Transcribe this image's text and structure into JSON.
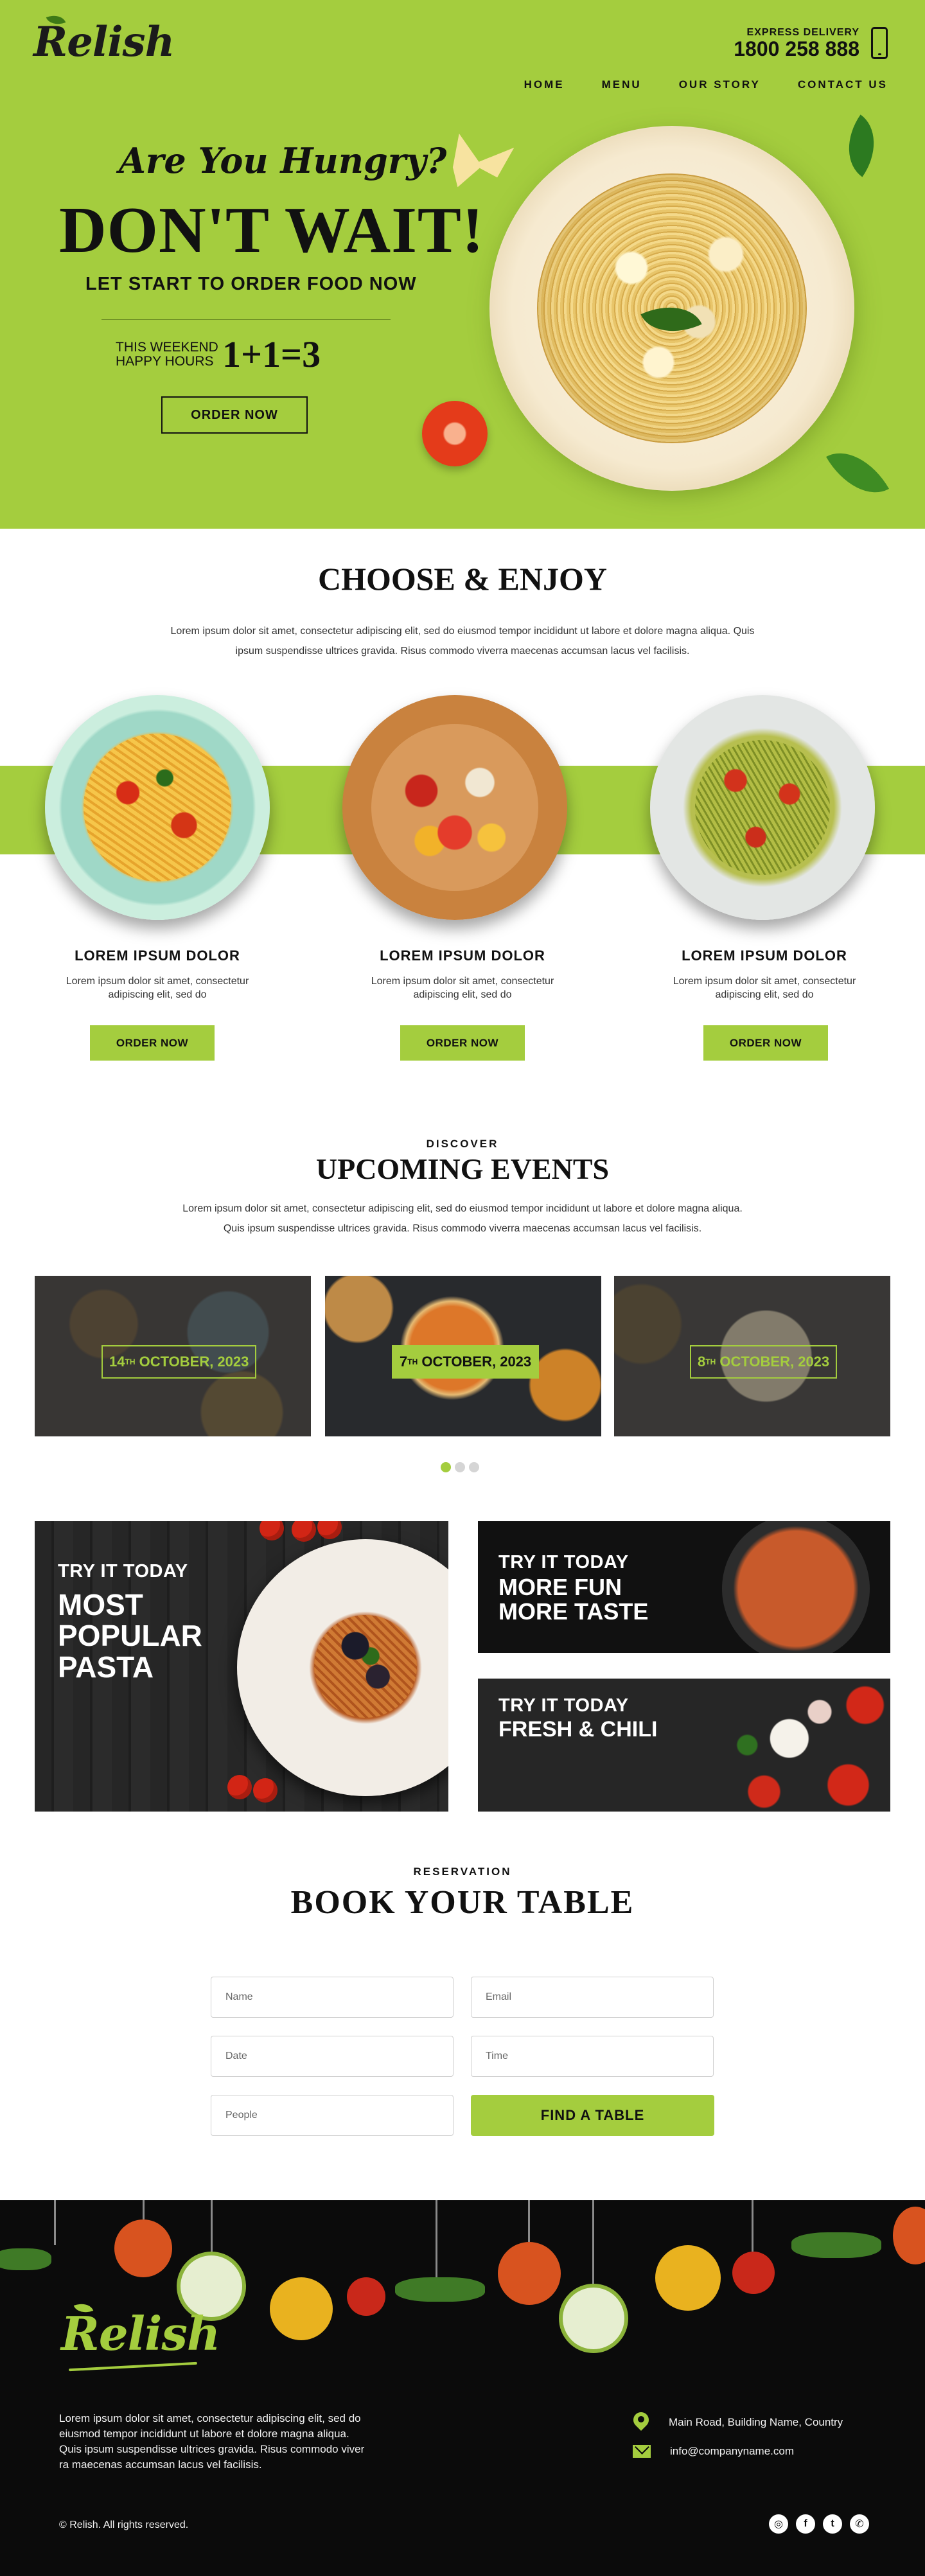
{
  "brand": {
    "logo_text": "Relish"
  },
  "header": {
    "delivery_label": "EXPRESS DELIVERY",
    "delivery_phone": "1800 258 888",
    "nav": [
      "HOME",
      "MENU",
      "OUR STORY",
      "CONTACT US"
    ]
  },
  "hero": {
    "tagline": "Are You Hungry?",
    "headline": "DON'T WAIT!",
    "subheadline": "LET START TO ORDER FOOD NOW",
    "happy_line1": "THIS WEEKEND",
    "happy_line2": "HAPPY HOURS",
    "happy_value": "1+1=3",
    "cta": "ORDER NOW"
  },
  "choose": {
    "title": "CHOOSE & ENJOY",
    "desc_line1": "Lorem ipsum dolor sit amet, consectetur adipiscing elit, sed do eiusmod tempor incididunt ut labore et dolore magna aliqua. Quis",
    "desc_line2": "ipsum suspendisse ultrices gravida. Risus commodo viverra maecenas accumsan lacus vel facilisis.",
    "items": [
      {
        "title": "LOREM IPSUM DOLOR",
        "desc_line1": "Lorem ipsum dolor sit amet, consectetur",
        "desc_line2": "adipiscing elit, sed do",
        "button": "ORDER NOW"
      },
      {
        "title": "LOREM IPSUM DOLOR",
        "desc_line1": "Lorem ipsum dolor sit amet, consectetur",
        "desc_line2": "adipiscing elit, sed do",
        "button": "ORDER NOW"
      },
      {
        "title": "LOREM IPSUM DOLOR",
        "desc_line1": "Lorem ipsum dolor sit amet, consectetur",
        "desc_line2": "adipiscing elit, sed do",
        "button": "ORDER NOW"
      }
    ]
  },
  "events": {
    "subtitle": "DISCOVER",
    "title": "UPCOMING EVENTS",
    "desc_line1": "Lorem ipsum dolor sit amet, consectetur adipiscing elit, sed do eiusmod tempor incididunt ut labore et dolore magna aliqua.",
    "desc_line2": "Quis ipsum suspendisse ultrices gravida. Risus commodo viverra maecenas accumsan lacus vel facilisis.",
    "cards": [
      {
        "day": "14",
        "suffix": "TH",
        "month_year": "OCTOBER, 2023"
      },
      {
        "day": "7",
        "suffix": "TH",
        "month_year": "OCTOBER, 2023"
      },
      {
        "day": "8",
        "suffix": "TH",
        "month_year": "OCTOBER, 2023"
      }
    ],
    "active_slide": 1,
    "slide_count": 3
  },
  "promos": {
    "big": {
      "label": "TRY IT TODAY",
      "line1": "MOST",
      "line2": "POPULAR",
      "line3": "PASTA"
    },
    "small1": {
      "label": "TRY IT TODAY",
      "line1": "MORE FUN",
      "line2": "MORE TASTE"
    },
    "small2": {
      "label": "TRY IT TODAY",
      "line1": "FRESH & CHILI"
    }
  },
  "reservation": {
    "subtitle": "RESERVATION",
    "title": "BOOK YOUR TABLE",
    "name_placeholder": "Name",
    "email_placeholder": "Email",
    "date_placeholder": "Date",
    "time_placeholder": "Time",
    "people_placeholder": "People",
    "submit": "FIND A TABLE"
  },
  "footer": {
    "desc_line1": "Lorem ipsum dolor sit amet, consectetur adipiscing elit, sed do",
    "desc_line2": "eiusmod tempor incididunt ut labore et dolore magna aliqua.",
    "desc_line3": "Quis ipsum suspendisse ultrices gravida. Risus commodo viver",
    "desc_line4": "ra maecenas accumsan lacus vel facilisis.",
    "address": "Main Road, Building Name, Country",
    "email": "info@companyname.com",
    "copyright": "© Relish. All rights reserved.",
    "social": [
      {
        "icon": "instagram-icon",
        "glyph": "◎"
      },
      {
        "icon": "facebook-icon",
        "glyph": "f"
      },
      {
        "icon": "twitter-icon",
        "glyph": "t"
      },
      {
        "icon": "whatsapp-icon",
        "glyph": "✆"
      }
    ]
  },
  "colors": {
    "accent": "#a4cd3e",
    "dark": "#0b0b0b",
    "text": "#111111"
  }
}
